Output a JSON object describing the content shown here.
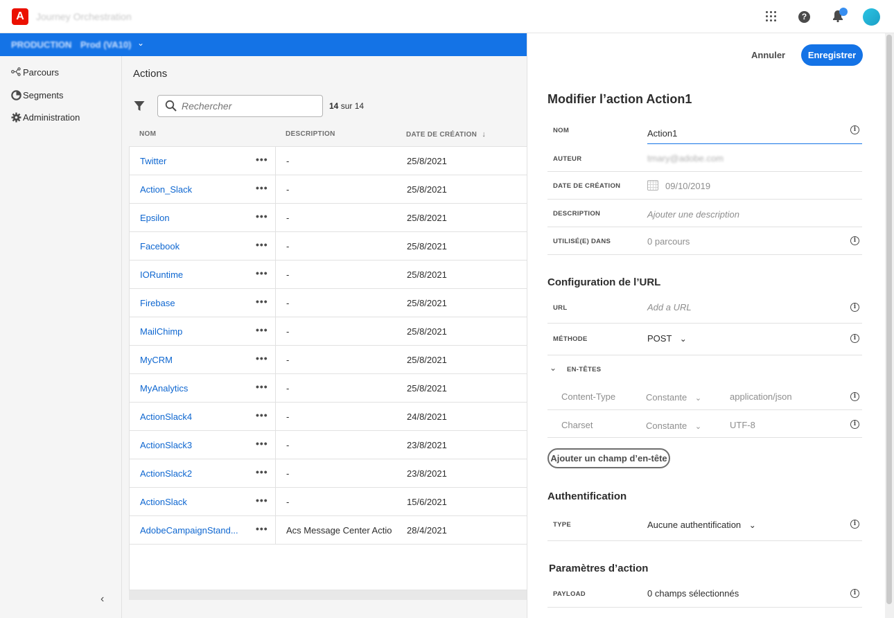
{
  "header": {
    "app_title": "Journey Orchestration",
    "logo_letter": "A"
  },
  "org_bar": {
    "org": "PRODUCTION",
    "sandbox": "Prod (VA10)"
  },
  "sidebar": {
    "items": [
      {
        "label": "Parcours",
        "icon": "journey-icon"
      },
      {
        "label": "Segments",
        "icon": "segments-icon"
      },
      {
        "label": "Administration",
        "icon": "gear-icon"
      }
    ],
    "collapse_glyph": "‹"
  },
  "main": {
    "title": "Actions",
    "search_placeholder": "Rechercher",
    "count_bold": "14",
    "count_rest": "sur 14",
    "columns": {
      "name": "NOM",
      "description": "DESCRIPTION",
      "created": "DATE DE CRÉATION"
    },
    "rows": [
      {
        "name": "Twitter",
        "description": "-",
        "date": "25/8/2021"
      },
      {
        "name": "Action_Slack",
        "description": "-",
        "date": "25/8/2021"
      },
      {
        "name": "Epsilon",
        "description": "-",
        "date": "25/8/2021"
      },
      {
        "name": "Facebook",
        "description": "-",
        "date": "25/8/2021"
      },
      {
        "name": "IORuntime",
        "description": "-",
        "date": "25/8/2021"
      },
      {
        "name": "Firebase",
        "description": "-",
        "date": "25/8/2021"
      },
      {
        "name": "MailChimp",
        "description": "-",
        "date": "25/8/2021"
      },
      {
        "name": "MyCRM",
        "description": "-",
        "date": "25/8/2021"
      },
      {
        "name": "MyAnalytics",
        "description": "-",
        "date": "25/8/2021"
      },
      {
        "name": "ActionSlack4",
        "description": "-",
        "date": "24/8/2021"
      },
      {
        "name": "ActionSlack3",
        "description": "-",
        "date": "23/8/2021"
      },
      {
        "name": "ActionSlack2",
        "description": "-",
        "date": "23/8/2021"
      },
      {
        "name": "ActionSlack",
        "description": "-",
        "date": "15/6/2021"
      },
      {
        "name": "AdobeCampaignStand...",
        "description": "Acs Message Center Actio",
        "date": "28/4/2021"
      }
    ],
    "more_glyph": "•••"
  },
  "panel": {
    "cancel_label": "Annuler",
    "save_label": "Enregistrer",
    "title": "Modifier l’action Action1",
    "fields": {
      "name_label": "NOM",
      "name_value": "Action1",
      "author_label": "AUTEUR",
      "author_value": "tmary@adobe.com",
      "created_label": "DATE DE CRÉATION",
      "created_value": "09/10/2019",
      "description_label": "DESCRIPTION",
      "description_placeholder": "Ajouter une description",
      "used_label": "UTILISÉ(E) DANS",
      "used_value": "0 parcours"
    },
    "url_section": {
      "title": "Configuration de l’URL",
      "url_label": "URL",
      "url_placeholder": "Add a URL",
      "method_label": "MÉTHODE",
      "method_value": "POST",
      "headers_label": "EN-TÊTES",
      "headers": [
        {
          "key": "Content-Type",
          "type": "Constante",
          "value": "application/json"
        },
        {
          "key": "Charset",
          "type": "Constante",
          "value": "UTF-8"
        }
      ],
      "add_header_label": "Ajouter un champ d’en-tête"
    },
    "auth_section": {
      "title": "Authentification",
      "type_label": "TYPE",
      "type_value": "Aucune authentification"
    },
    "params_section": {
      "title": "Paramètres d’action",
      "payload_label": "PAYLOAD",
      "payload_value": "0 champs sélectionnés"
    },
    "info_glyph": "i"
  },
  "colors": {
    "accent": "#1473e6",
    "link": "#0d66d0",
    "logo": "#eb1000"
  }
}
